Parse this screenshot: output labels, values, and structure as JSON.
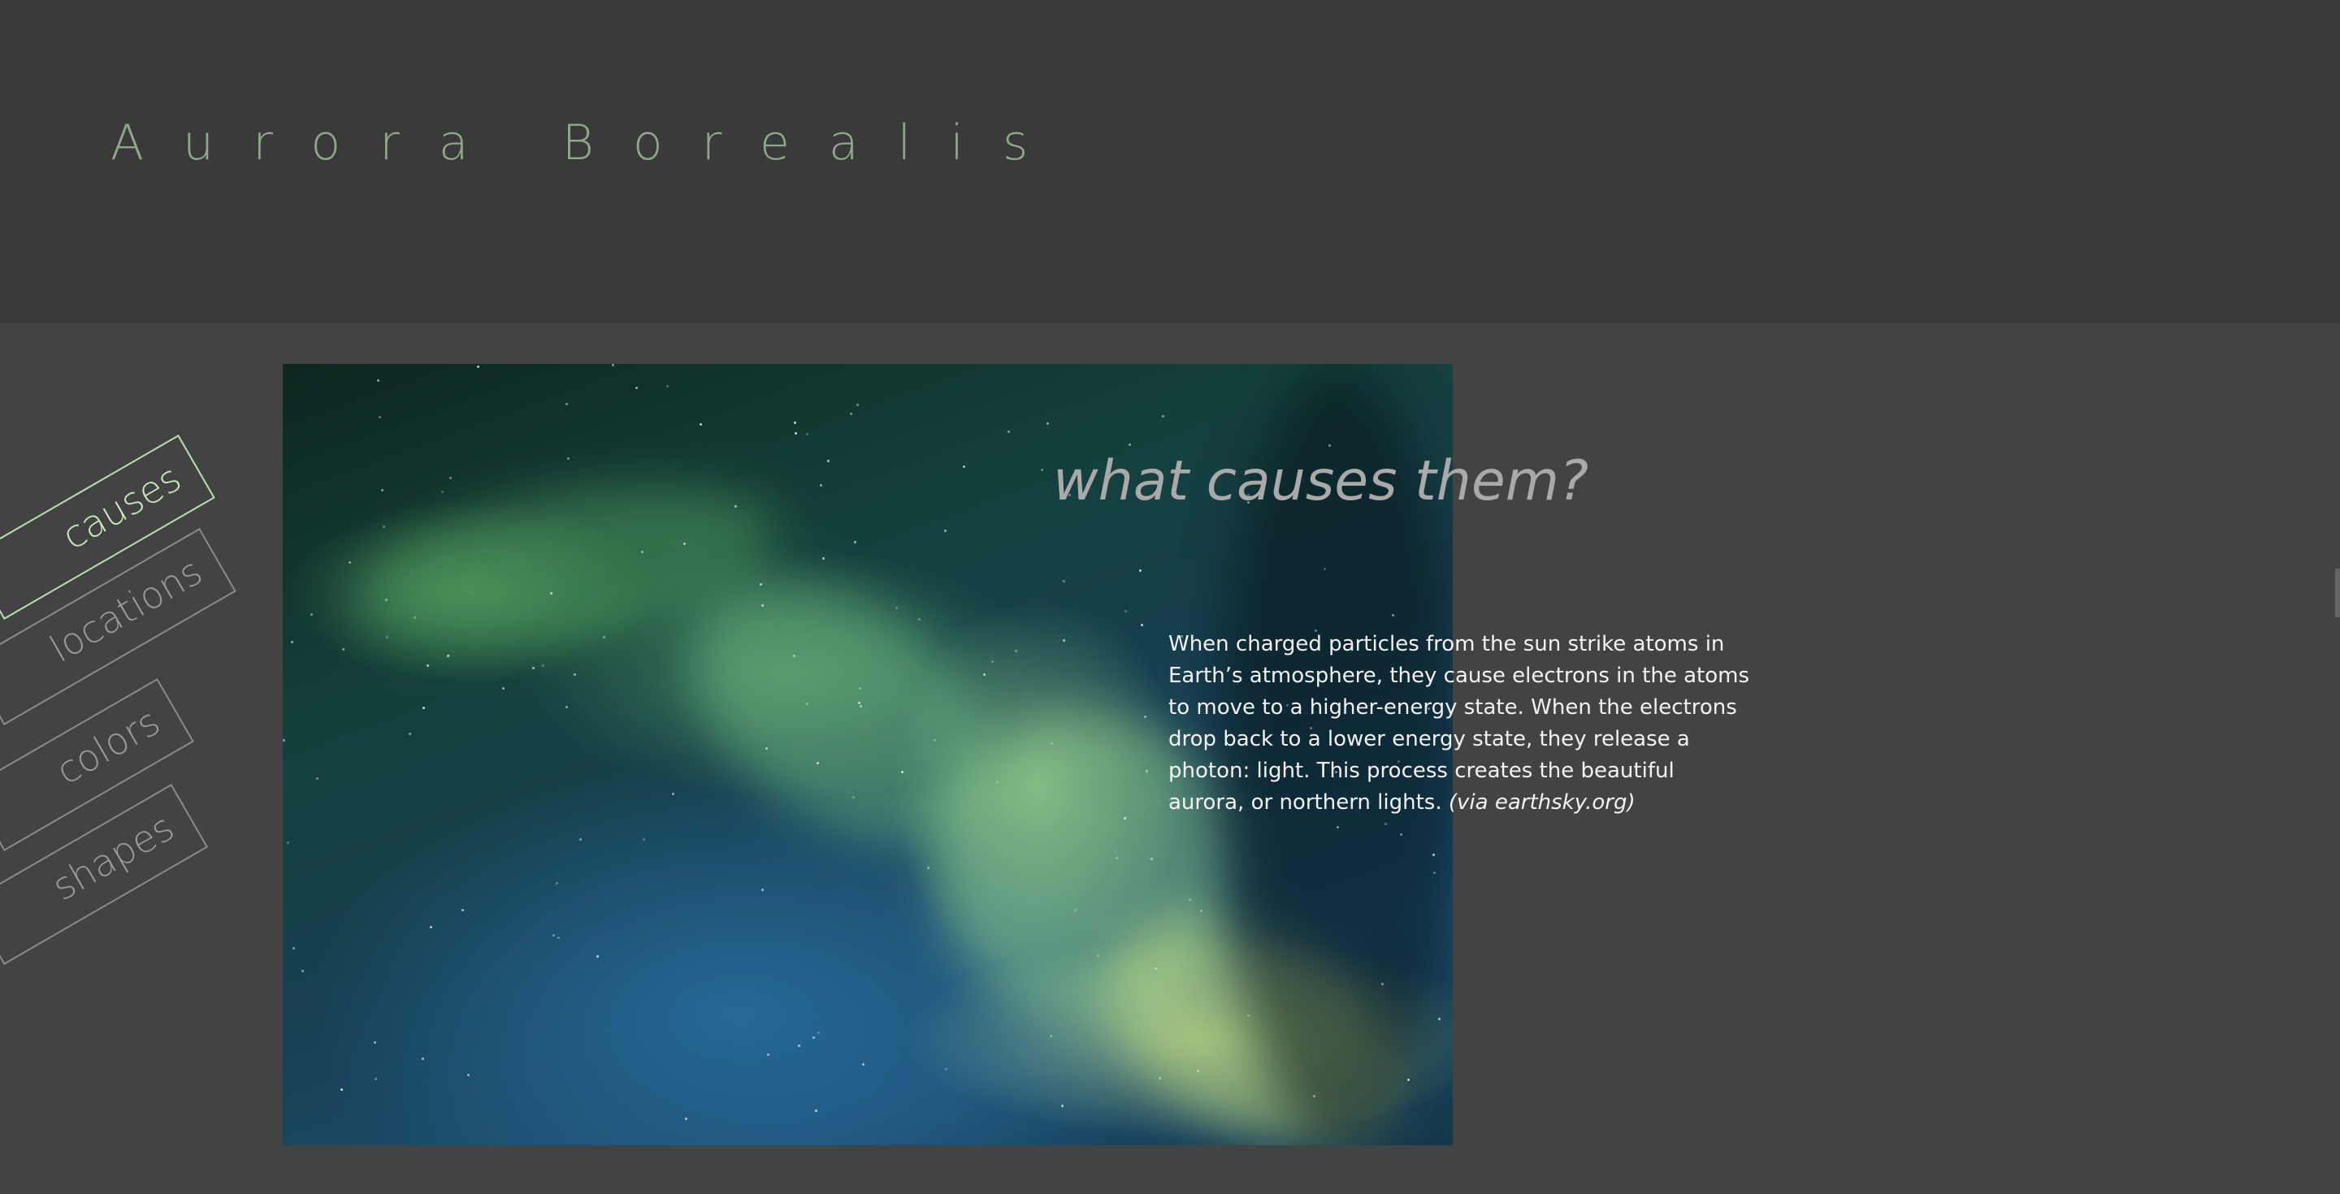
{
  "header": {
    "title": "Aurora Borealis"
  },
  "sidebar": {
    "tabs": [
      {
        "label": "causes",
        "active": true
      },
      {
        "label": "locations",
        "active": false
      },
      {
        "label": "colors",
        "active": false
      },
      {
        "label": "shapes",
        "active": false
      }
    ]
  },
  "main": {
    "image_alt_icon": "aurora-photo",
    "heading": "what causes them?",
    "body_text": "When charged particles from the sun strike atoms in Earth’s atmosphere, they cause electrons in the atoms to move to a higher-energy state. When the electrons drop back to a lower energy state, they release a photon: light. This process creates the beautiful aurora, or northern lights.",
    "source": "(via earthsky.org)"
  },
  "colors": {
    "header_bg": "#3a3a3a",
    "page_bg": "#434343",
    "title_color": "#8fa88a",
    "active_tab": "#c6ebbd",
    "inactive_tab": "#9a9a9a",
    "heading_color": "#a9a9a9"
  }
}
